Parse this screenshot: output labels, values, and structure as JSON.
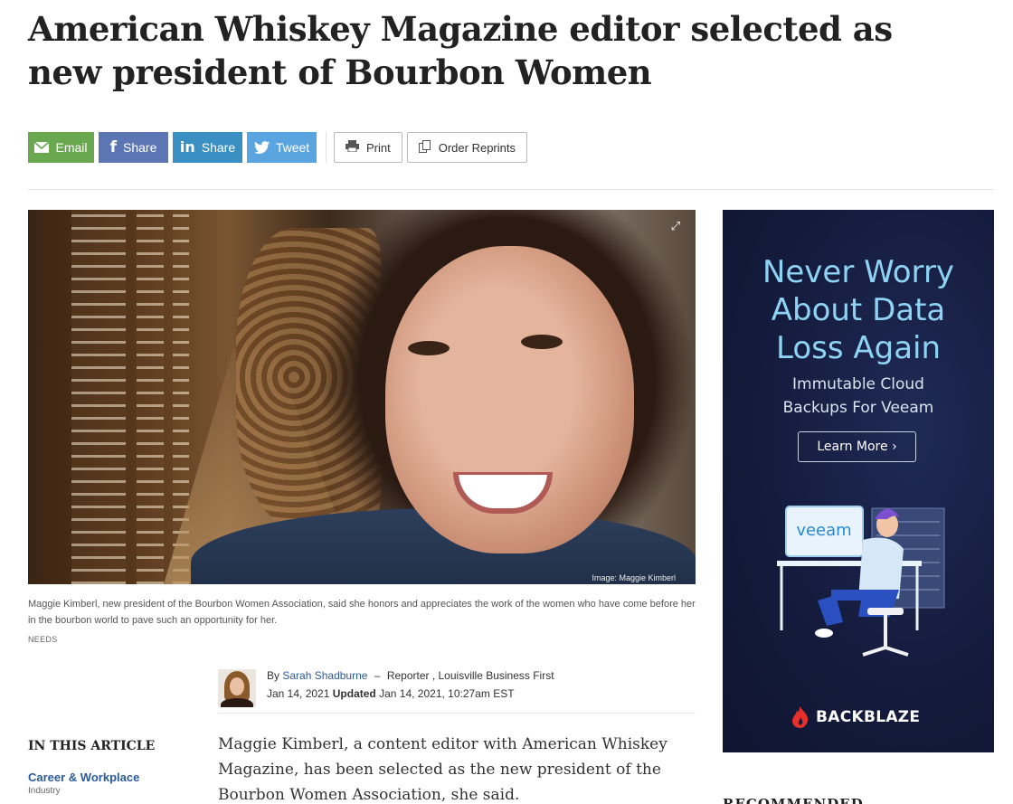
{
  "article": {
    "headline": "American Whiskey Magazine editor selected as new president of Bourbon Women"
  },
  "share": {
    "email": "Email",
    "facebook": "Share",
    "linkedin": "Share",
    "twitter": "Tweet",
    "print": "Print",
    "reprints": "Order Reprints"
  },
  "photo": {
    "credit": "Image: Maggie Kimberl",
    "caption": "Maggie Kimberl, new president of the Bourbon Women Association, said she honors and appreciates the work of the women who have come before her in the bourbon world to pave such an opportunity for her.",
    "source": "NEEDS"
  },
  "byline": {
    "by": "By",
    "author": "Sarah Shadburne",
    "dash": "–",
    "role": "Reporter , Louisville Business First",
    "date": "Jan 14, 2021",
    "updated_label": "Updated",
    "updated": "Jan 14, 2021, 10:27am EST"
  },
  "in_this_article": {
    "title": "IN THIS ARTICLE",
    "link": "Career & Workplace",
    "sub": "Industry"
  },
  "body": {
    "paragraph": "Maggie Kimberl, a content editor with American Whiskey Magazine, has been selected as the new president of the Bourbon Women Association, she said."
  },
  "ad": {
    "headline_1": "Never Worry",
    "headline_2": "About Data",
    "headline_3": "Loss Again",
    "sub_1": "Immutable Cloud",
    "sub_2": "Backups For Veeam",
    "button": "Learn More ›",
    "monitor_text": "veeam",
    "logo": "BACKBLAZE"
  },
  "sidebar": {
    "recommended": "RECOMMENDED"
  }
}
